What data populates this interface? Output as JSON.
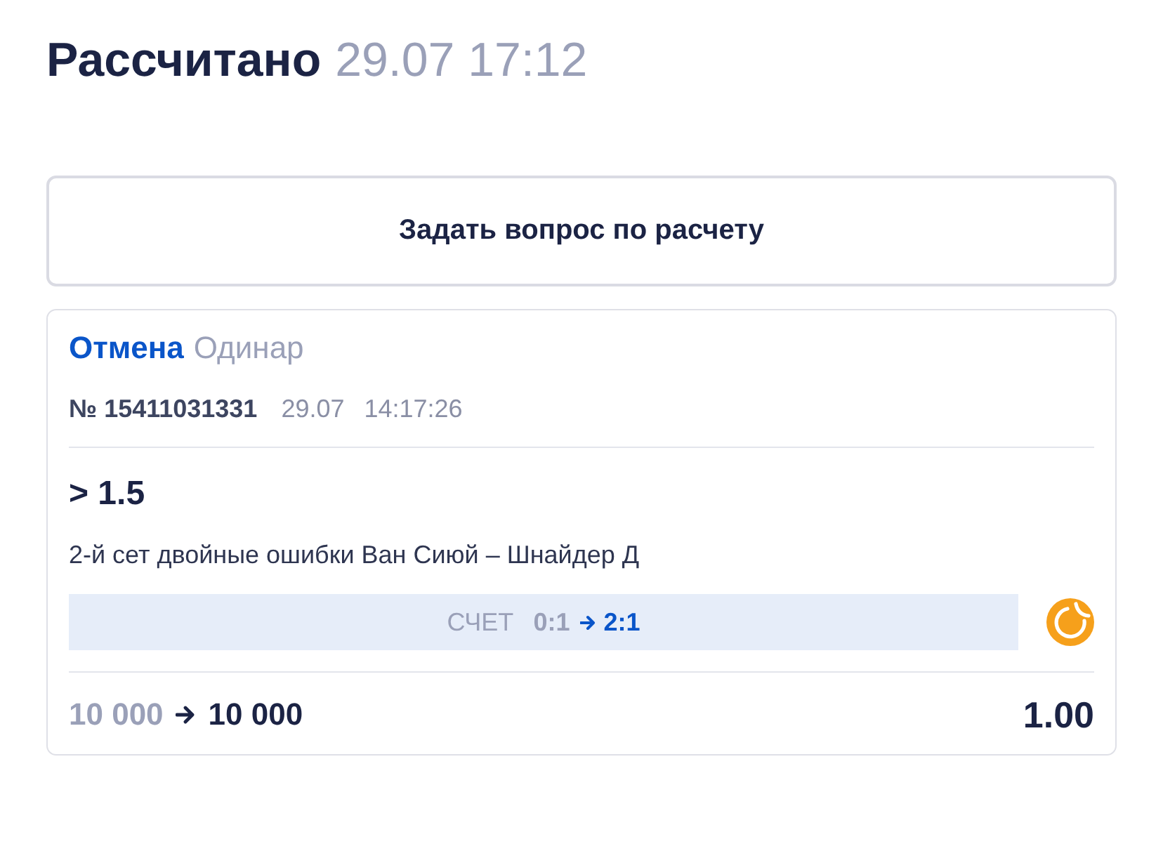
{
  "header": {
    "status": "Рассчитано",
    "datetime": "29.07 17:12"
  },
  "ask_button": {
    "label": "Задать вопрос по расчету"
  },
  "bet": {
    "result": "Отмена",
    "type": "Одинар",
    "number": "№ 15411031331",
    "date": "29.07",
    "time": "14:17:26",
    "selection": "> 1.5",
    "market": "2-й сет двойные ошибки Ван Сиюй – Шнайдер Д",
    "score": {
      "label": "СЧЕТ",
      "from": "0:1",
      "to": "2:1"
    },
    "stake": "10 000",
    "payout": "10 000",
    "odds": "1.00"
  }
}
